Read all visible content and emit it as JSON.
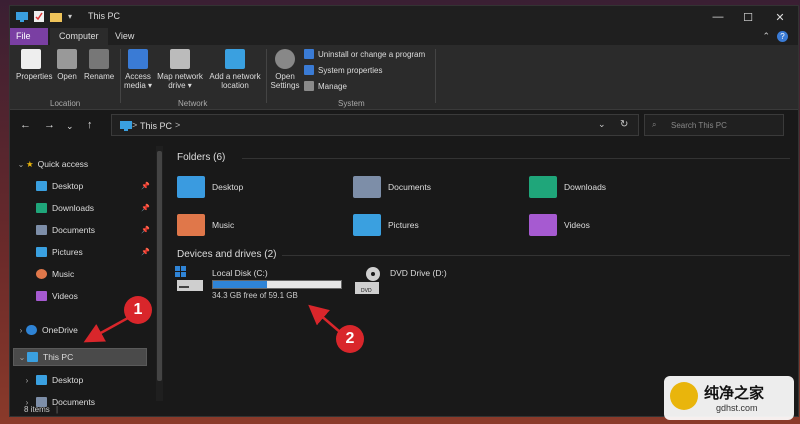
{
  "titlebar": {
    "title": "This PC"
  },
  "ribbon_tabs": [
    {
      "label": "File"
    },
    {
      "label": "Computer"
    },
    {
      "label": "View"
    }
  ],
  "ribbon": {
    "location": {
      "properties": "Properties",
      "open": "Open",
      "rename": "Rename",
      "group": "Location"
    },
    "network": {
      "access_media_1": "Access",
      "access_media_2": "media ▾",
      "map_drive_1": "Map network",
      "map_drive_2": "drive ▾",
      "add_location_1": "Add a network",
      "add_location_2": "location",
      "group": "Network"
    },
    "system": {
      "open_settings_1": "Open",
      "open_settings_2": "Settings",
      "uninstall": "Uninstall or change a program",
      "sys_props": "System properties",
      "manage": "Manage",
      "group": "System"
    }
  },
  "address": {
    "path": "This PC",
    "separator": ">"
  },
  "search": {
    "placeholder": "Search This PC"
  },
  "nav": {
    "quick_access": "Quick access",
    "pinned": [
      {
        "label": "Desktop",
        "pinned": true
      },
      {
        "label": "Downloads",
        "pinned": true
      },
      {
        "label": "Documents",
        "pinned": true
      },
      {
        "label": "Pictures",
        "pinned": true
      },
      {
        "label": "Music",
        "pinned": false
      },
      {
        "label": "Videos",
        "pinned": false
      }
    ],
    "onedrive": "OneDrive",
    "this_pc": "This PC",
    "children": [
      {
        "label": "Desktop"
      },
      {
        "label": "Documents"
      }
    ]
  },
  "folders_section": "Folders (6)",
  "folders": [
    {
      "label": "Desktop",
      "color": "#3a9be0"
    },
    {
      "label": "Documents",
      "color": "#7d8ea8"
    },
    {
      "label": "Downloads",
      "color": "#1fa67a"
    },
    {
      "label": "Music",
      "color": "#e0774a"
    },
    {
      "label": "Pictures",
      "color": "#3aa0e0"
    },
    {
      "label": "Videos",
      "color": "#a65ad1"
    }
  ],
  "drives_section": "Devices and drives (2)",
  "drives": [
    {
      "label": "Local Disk (C:)",
      "free_text": "34.3 GB free of 59.1 GB",
      "used_fraction": 0.42
    },
    {
      "label": "DVD Drive (D:)",
      "dvd_text": "DVD"
    }
  ],
  "status": {
    "items": "8 items"
  },
  "annotations": {
    "one": "1",
    "two": "2"
  },
  "watermark": {
    "title": "纯净之家",
    "url": "gdhst.com"
  },
  "colors": {
    "accent": "#2f84d6",
    "file_tab": "#7a3fa3",
    "annotation": "#d9262b"
  }
}
